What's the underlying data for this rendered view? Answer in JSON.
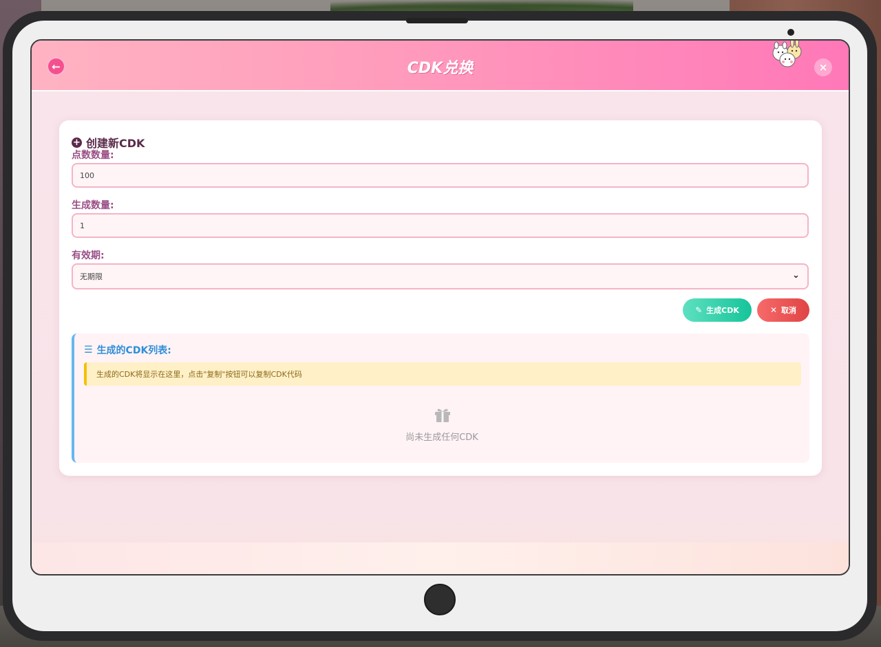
{
  "header": {
    "title": "CDK兑换",
    "back_icon": "←",
    "close_icon": "×"
  },
  "form": {
    "section_title": "创建新CDK",
    "points_label": "点数数量:",
    "points_value": "100",
    "count_label": "生成数量:",
    "count_value": "1",
    "validity_label": "有效期:",
    "validity_value": "无期限",
    "generate_label": "生成CDK",
    "cancel_label": "取消"
  },
  "list": {
    "title": "生成的CDK列表:",
    "notice": "生成的CDK将显示在这里，点击\"复制\"按钮可以复制CDK代码",
    "empty_text": "尚未生成任何CDK"
  },
  "colors": {
    "header_start": "#ffb3c2",
    "header_end": "#ff78b8",
    "accent_green": "#16c49a",
    "accent_red": "#e04444",
    "list_accent": "#68b6f0"
  }
}
